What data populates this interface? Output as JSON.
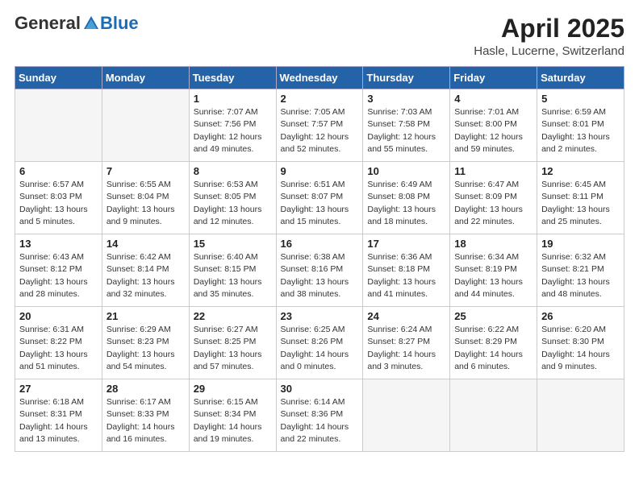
{
  "logo": {
    "general": "General",
    "blue": "Blue"
  },
  "title": "April 2025",
  "location": "Hasle, Lucerne, Switzerland",
  "days_of_week": [
    "Sunday",
    "Monday",
    "Tuesday",
    "Wednesday",
    "Thursday",
    "Friday",
    "Saturday"
  ],
  "weeks": [
    [
      {
        "day": "",
        "info": ""
      },
      {
        "day": "",
        "info": ""
      },
      {
        "day": "1",
        "info": "Sunrise: 7:07 AM\nSunset: 7:56 PM\nDaylight: 12 hours and 49 minutes."
      },
      {
        "day": "2",
        "info": "Sunrise: 7:05 AM\nSunset: 7:57 PM\nDaylight: 12 hours and 52 minutes."
      },
      {
        "day": "3",
        "info": "Sunrise: 7:03 AM\nSunset: 7:58 PM\nDaylight: 12 hours and 55 minutes."
      },
      {
        "day": "4",
        "info": "Sunrise: 7:01 AM\nSunset: 8:00 PM\nDaylight: 12 hours and 59 minutes."
      },
      {
        "day": "5",
        "info": "Sunrise: 6:59 AM\nSunset: 8:01 PM\nDaylight: 13 hours and 2 minutes."
      }
    ],
    [
      {
        "day": "6",
        "info": "Sunrise: 6:57 AM\nSunset: 8:03 PM\nDaylight: 13 hours and 5 minutes."
      },
      {
        "day": "7",
        "info": "Sunrise: 6:55 AM\nSunset: 8:04 PM\nDaylight: 13 hours and 9 minutes."
      },
      {
        "day": "8",
        "info": "Sunrise: 6:53 AM\nSunset: 8:05 PM\nDaylight: 13 hours and 12 minutes."
      },
      {
        "day": "9",
        "info": "Sunrise: 6:51 AM\nSunset: 8:07 PM\nDaylight: 13 hours and 15 minutes."
      },
      {
        "day": "10",
        "info": "Sunrise: 6:49 AM\nSunset: 8:08 PM\nDaylight: 13 hours and 18 minutes."
      },
      {
        "day": "11",
        "info": "Sunrise: 6:47 AM\nSunset: 8:09 PM\nDaylight: 13 hours and 22 minutes."
      },
      {
        "day": "12",
        "info": "Sunrise: 6:45 AM\nSunset: 8:11 PM\nDaylight: 13 hours and 25 minutes."
      }
    ],
    [
      {
        "day": "13",
        "info": "Sunrise: 6:43 AM\nSunset: 8:12 PM\nDaylight: 13 hours and 28 minutes."
      },
      {
        "day": "14",
        "info": "Sunrise: 6:42 AM\nSunset: 8:14 PM\nDaylight: 13 hours and 32 minutes."
      },
      {
        "day": "15",
        "info": "Sunrise: 6:40 AM\nSunset: 8:15 PM\nDaylight: 13 hours and 35 minutes."
      },
      {
        "day": "16",
        "info": "Sunrise: 6:38 AM\nSunset: 8:16 PM\nDaylight: 13 hours and 38 minutes."
      },
      {
        "day": "17",
        "info": "Sunrise: 6:36 AM\nSunset: 8:18 PM\nDaylight: 13 hours and 41 minutes."
      },
      {
        "day": "18",
        "info": "Sunrise: 6:34 AM\nSunset: 8:19 PM\nDaylight: 13 hours and 44 minutes."
      },
      {
        "day": "19",
        "info": "Sunrise: 6:32 AM\nSunset: 8:21 PM\nDaylight: 13 hours and 48 minutes."
      }
    ],
    [
      {
        "day": "20",
        "info": "Sunrise: 6:31 AM\nSunset: 8:22 PM\nDaylight: 13 hours and 51 minutes."
      },
      {
        "day": "21",
        "info": "Sunrise: 6:29 AM\nSunset: 8:23 PM\nDaylight: 13 hours and 54 minutes."
      },
      {
        "day": "22",
        "info": "Sunrise: 6:27 AM\nSunset: 8:25 PM\nDaylight: 13 hours and 57 minutes."
      },
      {
        "day": "23",
        "info": "Sunrise: 6:25 AM\nSunset: 8:26 PM\nDaylight: 14 hours and 0 minutes."
      },
      {
        "day": "24",
        "info": "Sunrise: 6:24 AM\nSunset: 8:27 PM\nDaylight: 14 hours and 3 minutes."
      },
      {
        "day": "25",
        "info": "Sunrise: 6:22 AM\nSunset: 8:29 PM\nDaylight: 14 hours and 6 minutes."
      },
      {
        "day": "26",
        "info": "Sunrise: 6:20 AM\nSunset: 8:30 PM\nDaylight: 14 hours and 9 minutes."
      }
    ],
    [
      {
        "day": "27",
        "info": "Sunrise: 6:18 AM\nSunset: 8:31 PM\nDaylight: 14 hours and 13 minutes."
      },
      {
        "day": "28",
        "info": "Sunrise: 6:17 AM\nSunset: 8:33 PM\nDaylight: 14 hours and 16 minutes."
      },
      {
        "day": "29",
        "info": "Sunrise: 6:15 AM\nSunset: 8:34 PM\nDaylight: 14 hours and 19 minutes."
      },
      {
        "day": "30",
        "info": "Sunrise: 6:14 AM\nSunset: 8:36 PM\nDaylight: 14 hours and 22 minutes."
      },
      {
        "day": "",
        "info": ""
      },
      {
        "day": "",
        "info": ""
      },
      {
        "day": "",
        "info": ""
      }
    ]
  ]
}
